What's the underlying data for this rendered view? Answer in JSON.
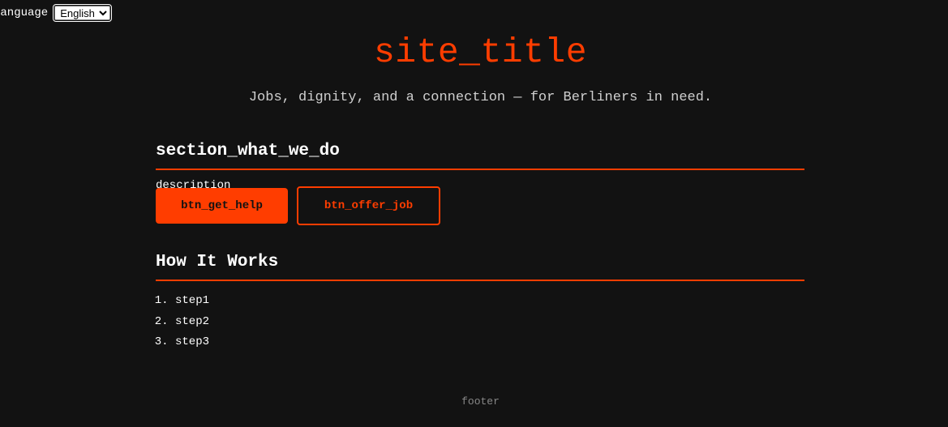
{
  "language": {
    "label": "Language",
    "selected": "English",
    "options": [
      "English"
    ]
  },
  "header": {
    "title": "site_title",
    "tagline": "Jobs, dignity, and a connection — for Berliners in need."
  },
  "what_we_do": {
    "heading": "section_what_we_do",
    "description": "description",
    "btn_get_help": "btn_get_help",
    "btn_offer_job": "btn_offer_job"
  },
  "how_it_works": {
    "heading": "How It Works",
    "steps": [
      "step1",
      "step2",
      "step3"
    ]
  },
  "footer": {
    "text": "footer"
  },
  "colors": {
    "background": "#121212",
    "accent": "#ff3d00",
    "text": "#ffffff",
    "muted": "#888888"
  }
}
